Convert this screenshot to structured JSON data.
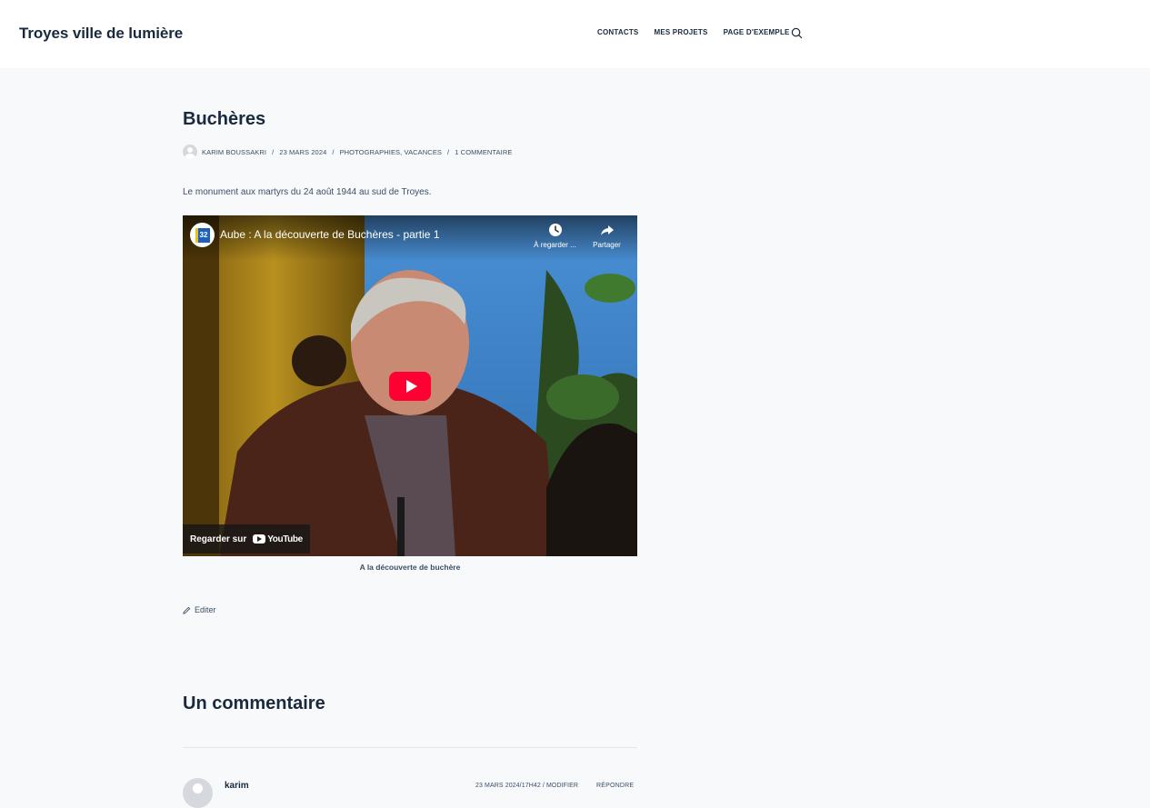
{
  "header": {
    "site_title": "Troyes ville de lumière",
    "nav": [
      "CONTACTS",
      "MES PROJETS",
      "PAGE D'EXEMPLE"
    ]
  },
  "post": {
    "title": "Buchères",
    "meta": {
      "author": "KARIM BOUSSAKRI",
      "date": "23 MARS 2024",
      "categories": "PHOTOGRAPHIES, VACANCES",
      "comments": "1 COMMENTAIRE",
      "separator": "/"
    },
    "intro": "Le monument aux martyrs du 24 août 1944 au sud de Troyes.",
    "video": {
      "channel_badge": "32",
      "title": "Aube : A la découverte de Buchères - partie 1",
      "watch_later": "À regarder ...",
      "share": "Partager",
      "watch_on": "Regarder sur",
      "youtube": "YouTube"
    },
    "caption": "A la découverte de buchère",
    "edit_label": "Editer"
  },
  "comments": {
    "title": "Un commentaire",
    "items": [
      {
        "author": "karim",
        "date": "23 MARS 2024/17H42 / MODIFIER",
        "reply": "RÉPONDRE"
      }
    ]
  }
}
